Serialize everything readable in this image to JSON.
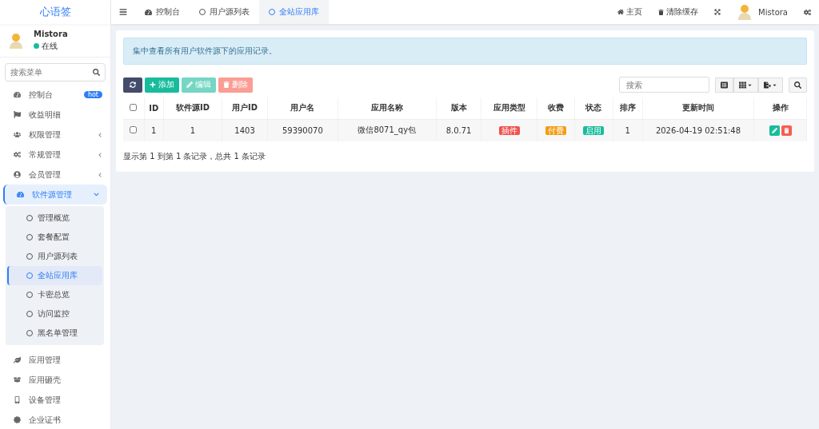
{
  "brand": "心语签",
  "tabs": [
    {
      "label": "控制台",
      "selected": false
    },
    {
      "label": "用户源列表",
      "selected": false
    },
    {
      "label": "全站应用库",
      "selected": true
    }
  ],
  "header_links": [
    {
      "label": "主页"
    },
    {
      "label": "清除缓存"
    }
  ],
  "header_user": "Mistora",
  "user": {
    "name": "Mistora",
    "status": "在线",
    "online": true
  },
  "menu_search": {
    "placeholder": "搜索菜单"
  },
  "menu": [
    {
      "kind": "link",
      "label": "控制台",
      "badge": "hot",
      "selected": false
    },
    {
      "kind": "link",
      "label": "收益明细",
      "selected": false
    },
    {
      "kind": "group",
      "label": "权限管理",
      "expanded": false,
      "selected": false
    },
    {
      "kind": "group",
      "label": "常规管理",
      "expanded": false,
      "selected": false
    },
    {
      "kind": "group",
      "label": "会员管理",
      "expanded": false,
      "selected": false
    },
    {
      "kind": "group",
      "label": "软件源管理",
      "expanded": true,
      "selected": true,
      "children": [
        {
          "label": "管理概览",
          "selected": false
        },
        {
          "label": "套餐配置",
          "selected": false
        },
        {
          "label": "用户源列表",
          "selected": false
        },
        {
          "label": "全站应用库",
          "selected": true
        },
        {
          "label": "卡密总览",
          "selected": false
        },
        {
          "label": "访问监控",
          "selected": false
        },
        {
          "label": "黑名单管理",
          "selected": false
        }
      ]
    },
    {
      "kind": "link",
      "label": "应用管理",
      "selected": false
    },
    {
      "kind": "link",
      "label": "应用砸壳",
      "selected": false
    },
    {
      "kind": "link",
      "label": "设备管理",
      "selected": false
    },
    {
      "kind": "link",
      "label": "企业证书",
      "selected": false
    }
  ],
  "notice": "集中查看所有用户软件源下的应用记录。",
  "toolbar": [
    {
      "kind": "refresh",
      "disabled": false
    },
    {
      "kind": "add",
      "label": "添加",
      "disabled": false
    },
    {
      "kind": "edit",
      "label": "编辑",
      "disabled": true
    },
    {
      "kind": "delete",
      "label": "删除",
      "disabled": true
    }
  ],
  "table_search": {
    "placeholder": "搜索"
  },
  "table": {
    "all_checked": false,
    "columns": [
      "ID",
      "软件源ID",
      "用户ID",
      "用户名",
      "应用名称",
      "版本",
      "应用类型",
      "收费",
      "状态",
      "排序",
      "更新时间",
      "操作"
    ],
    "rows": [
      {
        "checked": false,
        "id": "1",
        "source_id": "1",
        "user_id": "1403",
        "username": "59390070",
        "app_name": "微信8071_qy包",
        "version": "8.0.71",
        "type": {
          "label": "插件",
          "color": "#f0524f"
        },
        "fee": {
          "label": "付费",
          "color": "#f39c12"
        },
        "status": {
          "label": "启用",
          "color": "#18bc9c"
        },
        "sort": "1",
        "updated": "2026-04-19 02:51:48"
      }
    ]
  },
  "pagination_info": "显示第 1 到第 1 条记录，总共 1 条记录"
}
